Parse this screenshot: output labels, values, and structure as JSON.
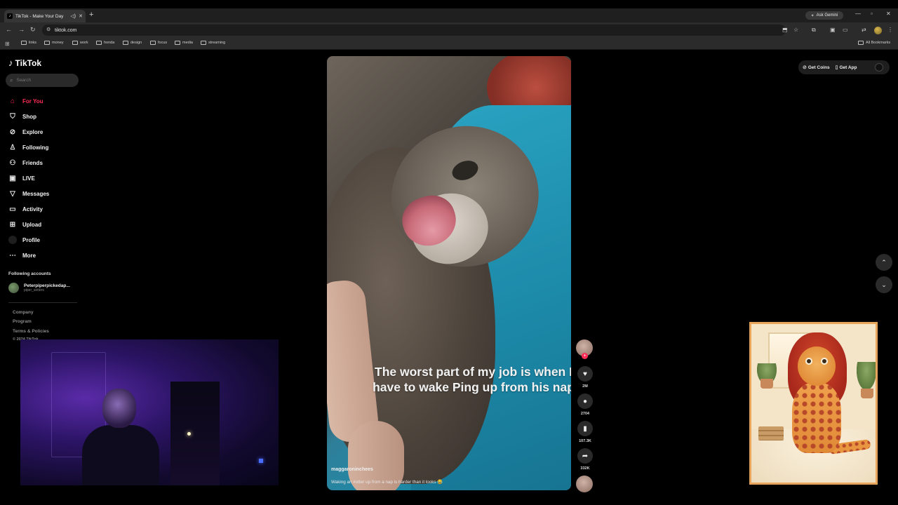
{
  "browser": {
    "tab_title": "TikTok - Make Your Day",
    "url": "tiktok.com",
    "ask_gemini": "Ask Gemini",
    "bookmarks": [
      "links",
      "money",
      "work",
      "honda",
      "design",
      "focus",
      "media",
      "streaming"
    ],
    "all_bookmarks": "All Bookmarks"
  },
  "sidebar": {
    "logo": "TikTok",
    "search_placeholder": "Search",
    "nav": [
      {
        "label": "For You",
        "icon": "home-icon",
        "active": true
      },
      {
        "label": "Shop",
        "icon": "shop-icon"
      },
      {
        "label": "Explore",
        "icon": "compass-icon"
      },
      {
        "label": "Following",
        "icon": "following-icon"
      },
      {
        "label": "Friends",
        "icon": "friends-icon"
      },
      {
        "label": "LIVE",
        "icon": "live-icon"
      },
      {
        "label": "Messages",
        "icon": "messages-icon"
      },
      {
        "label": "Activity",
        "icon": "activity-icon"
      },
      {
        "label": "Upload",
        "icon": "upload-icon"
      },
      {
        "label": "Profile",
        "icon": "profile-icon"
      },
      {
        "label": "More",
        "icon": "more-icon"
      }
    ],
    "following_heading": "Following accounts",
    "following": [
      {
        "name": "Peterpiperpickedap...",
        "handle": "piper_setters"
      }
    ],
    "footer": [
      "Company",
      "Program",
      "Terms & Policies",
      "© 2024 TikTok"
    ]
  },
  "video": {
    "caption": "The worst part of my job is when I have to wake Ping up from his nap",
    "creator": "maggaroninchees",
    "description": "Waking an #otter up from a nap is harder than it looks 😂"
  },
  "actions": {
    "likes": "2M",
    "comments": "2704",
    "saves": "107.3K",
    "shares": "332K"
  },
  "topbar": {
    "get_coins": "Get Coins",
    "get_app": "Get App"
  },
  "colors": {
    "accent": "#fe2c55",
    "background": "#000000"
  }
}
